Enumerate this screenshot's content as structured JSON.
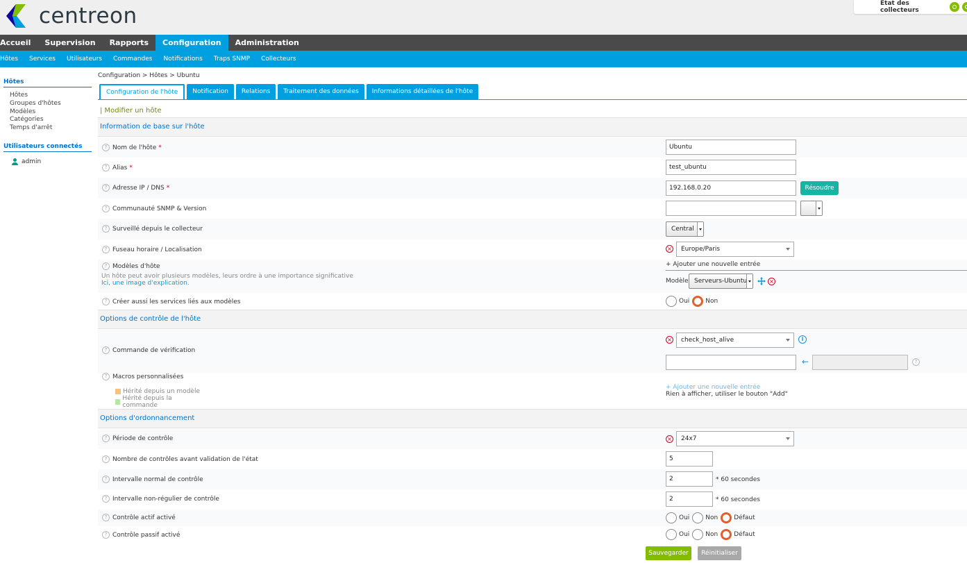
{
  "brand": {
    "name": "centreon"
  },
  "collectors": {
    "label": "État des collecteurs"
  },
  "main_nav": [
    "Accueil",
    "Supervision",
    "Rapports",
    "Configuration",
    "Administration"
  ],
  "sub_nav": [
    "Hôtes",
    "Services",
    "Utilisateurs",
    "Commandes",
    "Notifications",
    "Traps SNMP",
    "Collecteurs"
  ],
  "sidebar": {
    "hosts_title": "Hôtes",
    "hosts_items": [
      "Hôtes",
      "Groupes d'hôtes",
      "Modèles",
      "Catégories",
      "Temps d'arrêt"
    ],
    "users_title": "Utilisateurs connectés",
    "user": "admin"
  },
  "breadcrumb": "Configuration  >  Hôtes  >  Ubuntu",
  "tabs": [
    "Configuration de l'hôte",
    "Notification",
    "Relations",
    "Traitement des données",
    "Informations détaillées de l'hôte"
  ],
  "form_title": "| Modifier un hôte",
  "sections": {
    "basic": "Information de base sur l'hôte",
    "check": "Options de contrôle de l'hôte",
    "schedule": "Options d'ordonnancement"
  },
  "fields": {
    "host_name": {
      "label": "Nom de l'hôte",
      "value": "Ubuntu"
    },
    "alias": {
      "label": "Alias",
      "value": "test_ubuntu"
    },
    "address": {
      "label": "Adresse IP / DNS",
      "value": "192.168.0.20",
      "button": "Résoudre"
    },
    "snmp": {
      "label": "Communauté SNMP & Version",
      "value": ""
    },
    "poller": {
      "label": "Surveillé depuis le collecteur",
      "value": "Central"
    },
    "timezone": {
      "label": "Fuseau horaire / Localisation",
      "value": "Europe/Paris"
    },
    "templates": {
      "label": "Modèles d'hôte",
      "help1": "Un hôte peut avoir plusieurs modèles, leurs ordre à une importance significative",
      "help2_link": "Ici, une image d'explication.",
      "add": "+ Ajouter une nouvelle entrée",
      "model_label": "Modèle",
      "model_value": "Serveurs-Ubuntu"
    },
    "create_services": {
      "label": "Créer aussi les services liés aux modèles",
      "options": [
        "Oui",
        "Non"
      ],
      "selected": "Non"
    },
    "check_command": {
      "label": "Commande de vérification",
      "value": "check_host_alive"
    },
    "macros": {
      "label": "Macros personnalisées",
      "legend": [
        "Hérité depuis un modèle",
        "Hérité depuis la commande"
      ],
      "legend_colors": [
        "#f6c27e",
        "#b4e6a6"
      ],
      "add": "+ Ajouter une nouvelle entrée",
      "empty": "Rien à afficher, utiliser le bouton \"Add\""
    },
    "check_period": {
      "label": "Période de contrôle",
      "value": "24x7"
    },
    "max_attempts": {
      "label": "Nombre de contrôles avant validation de l'état",
      "value": "5"
    },
    "normal_interval": {
      "label": "Intervalle normal de contrôle",
      "value": "2",
      "unit": "* 60 secondes"
    },
    "retry_interval": {
      "label": "Intervalle non-régulier de contrôle",
      "value": "2",
      "unit": "* 60 secondes"
    },
    "active_checks": {
      "label": "Contrôle actif activé",
      "options": [
        "Oui",
        "Non",
        "Défaut"
      ],
      "selected": "Défaut"
    },
    "passive_checks": {
      "label": "Contrôle passif activé",
      "options": [
        "Oui",
        "Non",
        "Défaut"
      ],
      "selected": "Défaut"
    }
  },
  "buttons": {
    "save": "Sauvegarder",
    "reset": "Réinitialiser"
  },
  "colors": {
    "accent": "#009fdf",
    "nav_dark": "#4a4a4a",
    "save": "#84bd00",
    "reset": "#a8a8a8"
  }
}
